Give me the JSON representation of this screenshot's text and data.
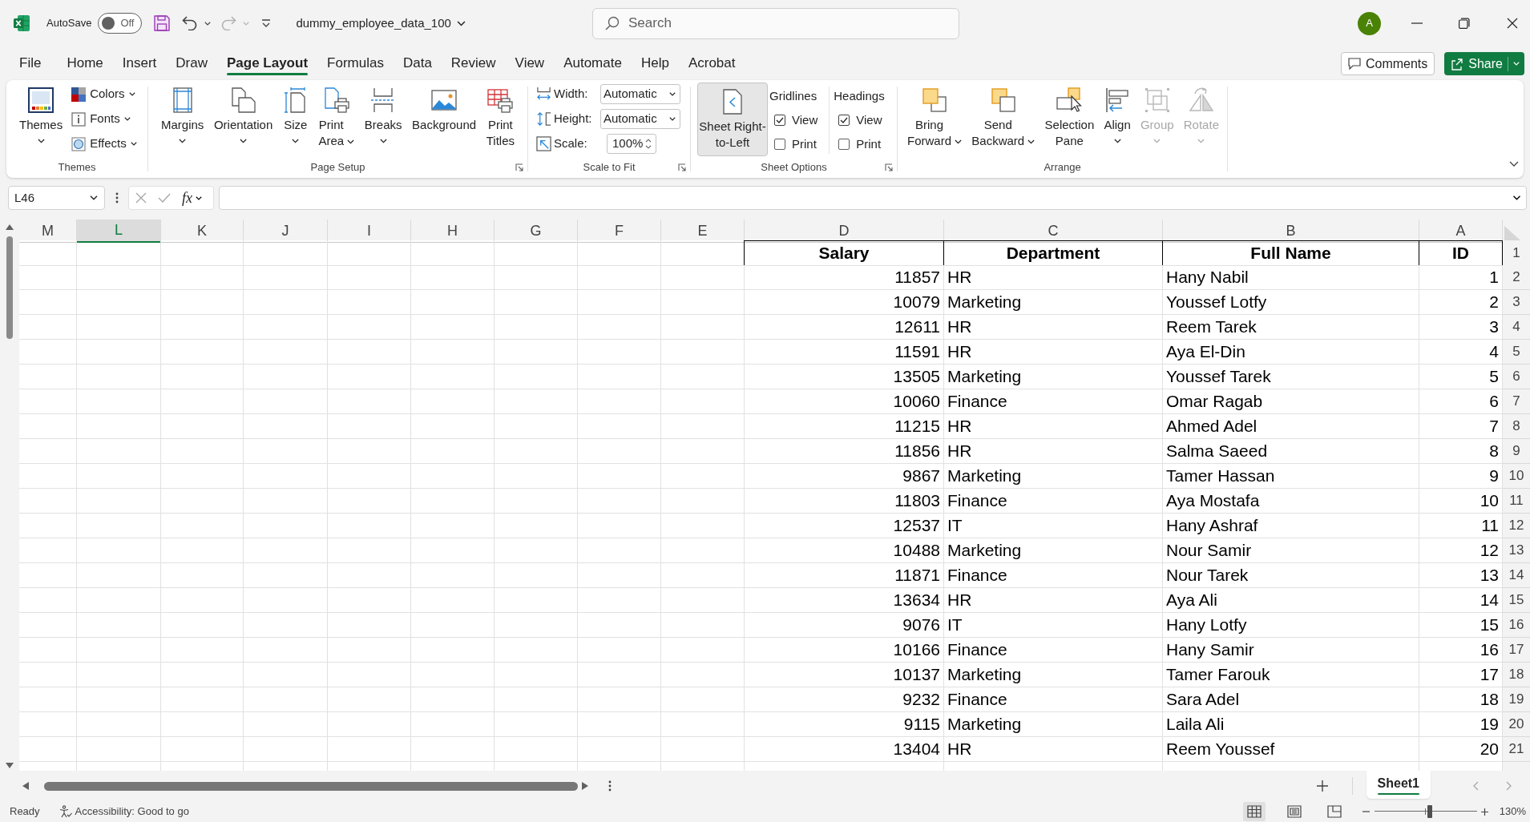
{
  "title_bar": {
    "autosave": {
      "label": "AutoSave",
      "on": false,
      "state_label": "Off"
    },
    "quick_access": [
      {
        "kind": "save",
        "disabled": false
      },
      {
        "kind": "undo",
        "disabled": false
      },
      {
        "kind": "redo",
        "disabled": true
      },
      {
        "kind": "customize",
        "disabled": false
      }
    ],
    "file_name": "dummy_employee_data_100",
    "search": {
      "placeholder": "Search"
    },
    "avatar": "A"
  },
  "menu_tabs": [
    {
      "label": "File",
      "selected": false
    },
    {
      "label": "Home",
      "selected": false
    },
    {
      "label": "Insert",
      "selected": false
    },
    {
      "label": "Draw",
      "selected": false
    },
    {
      "label": "Page Layout",
      "selected": true
    },
    {
      "label": "Formulas",
      "selected": false
    },
    {
      "label": "Data",
      "selected": false
    },
    {
      "label": "Review",
      "selected": false
    },
    {
      "label": "View",
      "selected": false
    },
    {
      "label": "Automate",
      "selected": false
    },
    {
      "label": "Help",
      "selected": false
    },
    {
      "label": "Acrobat",
      "selected": false
    }
  ],
  "comments_button": "Comments",
  "share_button": "Share",
  "ribbon": {
    "groups": [
      {
        "kind": "themes",
        "label": "Themes",
        "launcher": false,
        "big_button": {
          "label": "Themes",
          "dropdown": true
        },
        "small_buttons": [
          {
            "label": "Colors"
          },
          {
            "label": "Fonts"
          },
          {
            "label": "Effects"
          }
        ]
      },
      {
        "kind": "page_setup",
        "label": "Page Setup",
        "launcher": true,
        "buttons": [
          {
            "label": "Margins",
            "dropdown": true
          },
          {
            "label": "Orientation",
            "dropdown": true
          },
          {
            "label": "Size",
            "dropdown": true
          },
          {
            "label": "Print Area",
            "dropdown": true
          },
          {
            "label": "Breaks",
            "dropdown": true
          },
          {
            "label": "Background",
            "dropdown": false
          },
          {
            "label": "Print Titles",
            "dropdown": false
          }
        ]
      },
      {
        "kind": "scale_to_fit",
        "label": "Scale to Fit",
        "launcher": true,
        "fields": [
          {
            "kind": "select",
            "label": "Width:",
            "value": "Automatic"
          },
          {
            "kind": "select",
            "label": "Height:",
            "value": "Automatic"
          },
          {
            "kind": "spin",
            "label": "Scale:",
            "value": "100%"
          }
        ]
      },
      {
        "kind": "sheet_options",
        "label": "Sheet Options",
        "launcher": true,
        "toggle_button": {
          "label": "Sheet Right-to-Left",
          "selected": true
        },
        "option_sets": [
          {
            "title": "Gridlines",
            "options": [
              {
                "label": "View",
                "checked": true
              },
              {
                "label": "Print",
                "checked": false
              }
            ]
          },
          {
            "title": "Headings",
            "options": [
              {
                "label": "View",
                "checked": true
              },
              {
                "label": "Print",
                "checked": false
              }
            ]
          }
        ]
      },
      {
        "kind": "arrange",
        "label": "Arrange",
        "launcher": false,
        "buttons": [
          {
            "label": "Bring Forward",
            "dropdown": true,
            "disabled": false
          },
          {
            "label": "Send Backward",
            "dropdown": true,
            "disabled": false
          },
          {
            "label": "Selection Pane",
            "dropdown": false,
            "disabled": false
          },
          {
            "label": "Align",
            "dropdown": true,
            "disabled": false
          },
          {
            "label": "Group",
            "dropdown": true,
            "disabled": true
          },
          {
            "label": "Rotate",
            "dropdown": true,
            "disabled": true
          }
        ]
      }
    ]
  },
  "formula_bar": {
    "name_box": "L46",
    "function_label": "fx"
  },
  "sheet": {
    "columns": [
      {
        "letter": "M",
        "selected": false
      },
      {
        "letter": "L",
        "selected": true
      },
      {
        "letter": "K",
        "selected": false
      },
      {
        "letter": "J",
        "selected": false
      },
      {
        "letter": "I",
        "selected": false
      },
      {
        "letter": "H",
        "selected": false
      },
      {
        "letter": "G",
        "selected": false
      },
      {
        "letter": "F",
        "selected": false
      },
      {
        "letter": "E",
        "selected": false
      },
      {
        "letter": "D",
        "selected": false
      },
      {
        "letter": "C",
        "selected": false
      },
      {
        "letter": "B",
        "selected": false
      },
      {
        "letter": "A",
        "selected": false
      }
    ],
    "rows": [
      {
        "number": "1",
        "kind": "header",
        "cells": [
          "",
          "",
          "",
          "",
          "",
          "",
          "",
          "",
          "",
          "Salary",
          "Department",
          "Full Name",
          "ID"
        ]
      },
      {
        "number": "2",
        "kind": "data",
        "cells": [
          "",
          "",
          "",
          "",
          "",
          "",
          "",
          "",
          "",
          "11857",
          "HR",
          "Hany Nabil",
          "1"
        ]
      },
      {
        "number": "3",
        "kind": "data",
        "cells": [
          "",
          "",
          "",
          "",
          "",
          "",
          "",
          "",
          "",
          "10079",
          "Marketing",
          "Youssef Lotfy",
          "2"
        ]
      },
      {
        "number": "4",
        "kind": "data",
        "cells": [
          "",
          "",
          "",
          "",
          "",
          "",
          "",
          "",
          "",
          "12611",
          "HR",
          "Reem Tarek",
          "3"
        ]
      },
      {
        "number": "5",
        "kind": "data",
        "cells": [
          "",
          "",
          "",
          "",
          "",
          "",
          "",
          "",
          "",
          "11591",
          "HR",
          "Aya El-Din",
          "4"
        ]
      },
      {
        "number": "6",
        "kind": "data",
        "cells": [
          "",
          "",
          "",
          "",
          "",
          "",
          "",
          "",
          "",
          "13505",
          "Marketing",
          "Youssef Tarek",
          "5"
        ]
      },
      {
        "number": "7",
        "kind": "data",
        "cells": [
          "",
          "",
          "",
          "",
          "",
          "",
          "",
          "",
          "",
          "10060",
          "Finance",
          "Omar Ragab",
          "6"
        ]
      },
      {
        "number": "8",
        "kind": "data",
        "cells": [
          "",
          "",
          "",
          "",
          "",
          "",
          "",
          "",
          "",
          "11215",
          "HR",
          "Ahmed Adel",
          "7"
        ]
      },
      {
        "number": "9",
        "kind": "data",
        "cells": [
          "",
          "",
          "",
          "",
          "",
          "",
          "",
          "",
          "",
          "11856",
          "HR",
          "Salma Saeed",
          "8"
        ]
      },
      {
        "number": "10",
        "kind": "data",
        "cells": [
          "",
          "",
          "",
          "",
          "",
          "",
          "",
          "",
          "",
          "9867",
          "Marketing",
          "Tamer Hassan",
          "9"
        ]
      },
      {
        "number": "11",
        "kind": "data",
        "cells": [
          "",
          "",
          "",
          "",
          "",
          "",
          "",
          "",
          "",
          "11803",
          "Finance",
          "Aya Mostafa",
          "10"
        ]
      },
      {
        "number": "12",
        "kind": "data",
        "cells": [
          "",
          "",
          "",
          "",
          "",
          "",
          "",
          "",
          "",
          "12537",
          "IT",
          "Hany Ashraf",
          "11"
        ]
      },
      {
        "number": "13",
        "kind": "data",
        "cells": [
          "",
          "",
          "",
          "",
          "",
          "",
          "",
          "",
          "",
          "10488",
          "Marketing",
          "Nour Samir",
          "12"
        ]
      },
      {
        "number": "14",
        "kind": "data",
        "cells": [
          "",
          "",
          "",
          "",
          "",
          "",
          "",
          "",
          "",
          "11871",
          "Finance",
          "Nour Tarek",
          "13"
        ]
      },
      {
        "number": "15",
        "kind": "data",
        "cells": [
          "",
          "",
          "",
          "",
          "",
          "",
          "",
          "",
          "",
          "13634",
          "HR",
          "Aya Ali",
          "14"
        ]
      },
      {
        "number": "16",
        "kind": "data",
        "cells": [
          "",
          "",
          "",
          "",
          "",
          "",
          "",
          "",
          "",
          "9076",
          "IT",
          "Hany Lotfy",
          "15"
        ]
      },
      {
        "number": "17",
        "kind": "data",
        "cells": [
          "",
          "",
          "",
          "",
          "",
          "",
          "",
          "",
          "",
          "10166",
          "Finance",
          "Hany Samir",
          "16"
        ]
      },
      {
        "number": "18",
        "kind": "data",
        "cells": [
          "",
          "",
          "",
          "",
          "",
          "",
          "",
          "",
          "",
          "10137",
          "Marketing",
          "Tamer Farouk",
          "17"
        ]
      },
      {
        "number": "19",
        "kind": "data",
        "cells": [
          "",
          "",
          "",
          "",
          "",
          "",
          "",
          "",
          "",
          "9232",
          "Finance",
          "Sara Adel",
          "18"
        ]
      },
      {
        "number": "20",
        "kind": "data",
        "cells": [
          "",
          "",
          "",
          "",
          "",
          "",
          "",
          "",
          "",
          "9115",
          "Marketing",
          "Laila Ali",
          "19"
        ]
      },
      {
        "number": "21",
        "kind": "data",
        "cells": [
          "",
          "",
          "",
          "",
          "",
          "",
          "",
          "",
          "",
          "13404",
          "HR",
          "Reem Youssef",
          "20"
        ]
      }
    ]
  },
  "sheet_tabs": [
    {
      "label": "Sheet1",
      "selected": true
    }
  ],
  "status_bar": {
    "status": "Ready",
    "accessibility": "Accessibility: Good to go",
    "views": [
      {
        "kind": "normal",
        "selected": true
      },
      {
        "kind": "page_layout",
        "selected": false
      },
      {
        "kind": "page_break",
        "selected": false
      }
    ],
    "zoom": {
      "level": 0.54,
      "reading": "130%"
    }
  }
}
